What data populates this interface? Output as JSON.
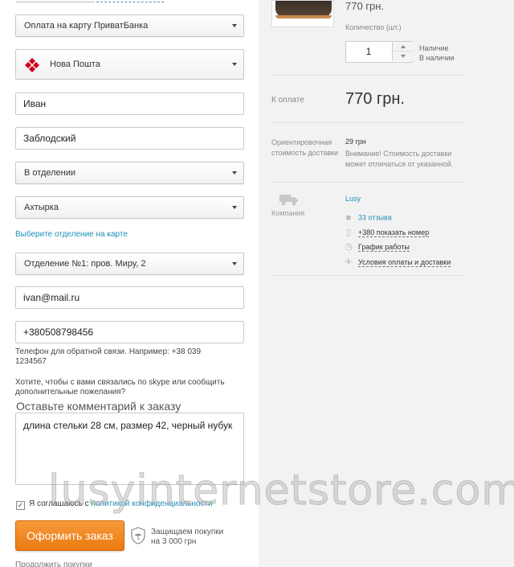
{
  "form": {
    "payment_select": "Оплата на карту ПриватБанка",
    "delivery_select": "Нова Пошта",
    "first_name": "Иван",
    "last_name": "Заблодский",
    "delivery_type_select": "В отделении",
    "city_select": "Ахтырка",
    "map_link": "Выберите отделение на карте",
    "branch_select": "Отделение №1: пров. Миру, 2",
    "email": "ivan@mail.ru",
    "phone": "+380508798456",
    "phone_hint_line1": "Телефон для обратной связи. Например: +38 039",
    "phone_hint_line2": "1234567",
    "skype_hint_line1": "Хотите, чтобы с вами связались по skype или сообщить",
    "skype_hint_line2": "дополнительные пожелания?",
    "comment_title": "Оставьте комментарий к заказу",
    "comment_value": "длина стельки 28 см, размер 42, черный нубук",
    "checkbox_mark": "✓",
    "agree_text": "Я соглашаюсь с ",
    "agree_link": "политикой конфиденциальности",
    "order_button": "Оформить заказ",
    "protect_line1": "Защищаем покупки",
    "protect_line2": "на 3 000 грн",
    "continue_text": "Продолжить покупки"
  },
  "summary": {
    "price_top": "770 грн.",
    "qty_label": "Количество (шт.)",
    "qty_value": "1",
    "avail_line1": "Наличие",
    "avail_line2": "В наличии",
    "pay_label": "К оплате",
    "pay_value": "770 грн.",
    "delivery_label": "Ориентировочная стоимость доставки",
    "delivery_value": "29 грн",
    "delivery_note": "Внимание! Стоимость доставки может отличаться от указанной.",
    "company_label": "Компания",
    "company_name": "Lusy",
    "reviews": "33 отзыва",
    "phone_show": "+380 показать номер",
    "schedule": "График работы",
    "terms": "Условия оплаты и доставки"
  },
  "icons": [
    "nova-poshta-logo-icon",
    "chevron-down-icon",
    "shield-umbrella-icon",
    "truck-icon",
    "comment-icon",
    "phone-icon",
    "clock-icon",
    "delivery-icon"
  ],
  "colors": {
    "accent": "#ea7a12",
    "link": "#1f8fb8",
    "sidebar_bg": "#f2f2f2",
    "brand_red": "#d0021b"
  },
  "watermark": "lusyinternetstore.com"
}
